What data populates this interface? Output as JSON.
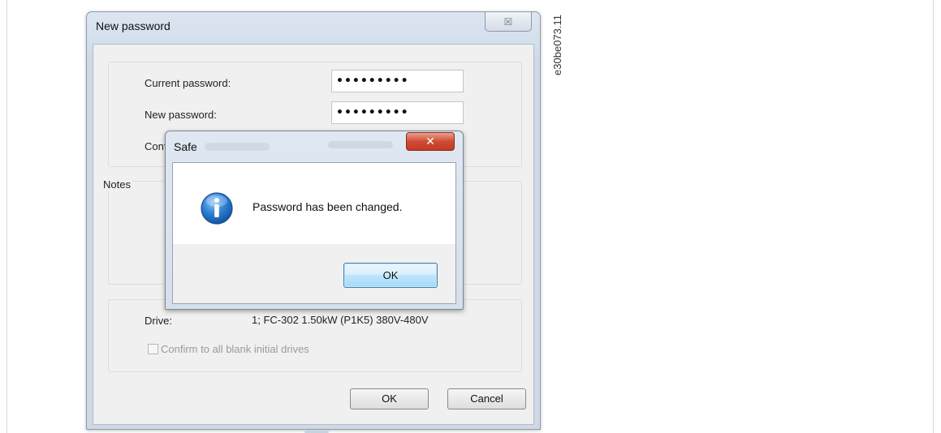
{
  "figure_id": "e30be073.11",
  "main_dialog": {
    "title": "New password",
    "close_glyph": "☒",
    "fields": [
      {
        "label": "Current password:",
        "value": "•••••••••"
      },
      {
        "label": "New password:",
        "value": "•••••••••"
      },
      {
        "label": "Conf"
      }
    ],
    "notes_label": "Notes",
    "drive_label": "Drive:",
    "drive_value": "1; FC-302 1.50kW (P1K5) 380V-480V",
    "confirm_checkbox_label": "Confirm to all blank initial drives",
    "ok_label": "OK",
    "cancel_label": "Cancel"
  },
  "message_box": {
    "title": "Safe",
    "close_glyph": "✕",
    "icon": "info-icon",
    "message": "Password has been changed.",
    "ok_label": "OK"
  }
}
